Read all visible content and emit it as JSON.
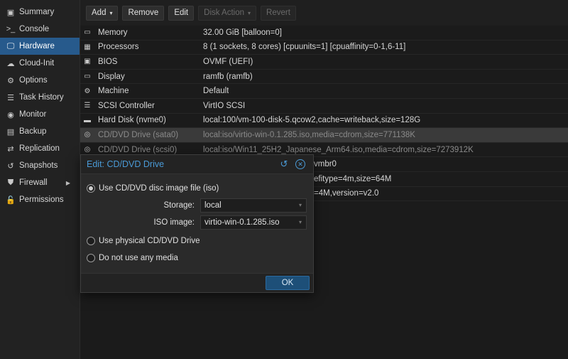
{
  "sidebar": {
    "items": [
      {
        "label": "Summary",
        "icon": "summary-icon",
        "glyph": "▣"
      },
      {
        "label": "Console",
        "icon": "console-icon",
        "glyph": ">_"
      },
      {
        "label": "Hardware",
        "icon": "monitor-icon",
        "glyph": "🖵"
      },
      {
        "label": "Cloud-Init",
        "icon": "cloud-icon",
        "glyph": "☁"
      },
      {
        "label": "Options",
        "icon": "gear-icon",
        "glyph": "⚙"
      },
      {
        "label": "Task History",
        "icon": "list-icon",
        "glyph": "☰"
      },
      {
        "label": "Monitor",
        "icon": "eye-icon",
        "glyph": "◉"
      },
      {
        "label": "Backup",
        "icon": "floppy-icon",
        "glyph": "▤"
      },
      {
        "label": "Replication",
        "icon": "retweet-icon",
        "glyph": "⇄"
      },
      {
        "label": "Snapshots",
        "icon": "history-icon",
        "glyph": "↺"
      },
      {
        "label": "Firewall",
        "icon": "shield-icon",
        "glyph": "⛊",
        "arrow": "▶"
      },
      {
        "label": "Permissions",
        "icon": "unlock-icon",
        "glyph": "🔓"
      }
    ]
  },
  "toolbar": {
    "add_label": "Add",
    "add_caret": "▾",
    "remove_label": "Remove",
    "edit_label": "Edit",
    "disk_action_label": "Disk Action",
    "disk_action_caret": "▾",
    "revert_label": "Revert"
  },
  "hardware": {
    "rows": [
      {
        "name": "Memory",
        "value": "32.00 GiB [balloon=0]",
        "icon": "memory-icon",
        "glyph": "▭"
      },
      {
        "name": "Processors",
        "value": "8 (1 sockets, 8 cores) [cpuunits=1] [cpuaffinity=0-1,6-11]",
        "icon": "cpu-icon",
        "glyph": "▦"
      },
      {
        "name": "BIOS",
        "value": "OVMF (UEFI)",
        "icon": "chip-icon",
        "glyph": "▣"
      },
      {
        "name": "Display",
        "value": "ramfb (ramfb)",
        "icon": "desktop-icon",
        "glyph": "▭"
      },
      {
        "name": "Machine",
        "value": "Default",
        "icon": "cogs-icon",
        "glyph": "⚙"
      },
      {
        "name": "SCSI Controller",
        "value": "VirtIO SCSI",
        "icon": "database-icon",
        "glyph": "☰"
      },
      {
        "name": "Hard Disk (nvme0)",
        "value": "local:100/vm-100-disk-5.qcow2,cache=writeback,size=128G",
        "icon": "hdd-icon",
        "glyph": "▬"
      },
      {
        "name": "CD/DVD Drive (sata0)",
        "value": "local:iso/virtio-win-0.1.285.iso,media=cdrom,size=771138K",
        "icon": "cdrom-icon",
        "glyph": "◎"
      },
      {
        "name": "CD/DVD Drive (scsi0)",
        "value": "local:iso/Win11_25H2_Japanese_Arm64.iso,media=cdrom,size=7273912K",
        "icon": "cdrom-icon",
        "glyph": "◎"
      },
      {
        "name": "",
        "value": "vmbr0",
        "icon": "",
        "glyph": ""
      },
      {
        "name": "",
        "value": "efitype=4m,size=64M",
        "icon": "",
        "glyph": ""
      },
      {
        "name": "",
        "value": "=4M,version=v2.0",
        "icon": "",
        "glyph": ""
      }
    ]
  },
  "dialog": {
    "title": "Edit: CD/DVD Drive",
    "reset_glyph": "↺",
    "close_glyph": "✕",
    "option_iso_label": "Use CD/DVD disc image file (iso)",
    "storage_label": "Storage:",
    "storage_value": "local",
    "iso_label": "ISO image:",
    "iso_value": "virtio-win-0.1.285.iso",
    "select_caret": "▾",
    "option_physical_label": "Use physical CD/DVD Drive",
    "option_none_label": "Do not use any media",
    "ok_label": "OK"
  },
  "colors": {
    "accent": "#4a9ad6",
    "sidebar_active": "#275a8c",
    "ok_button": "#1d4f78"
  }
}
